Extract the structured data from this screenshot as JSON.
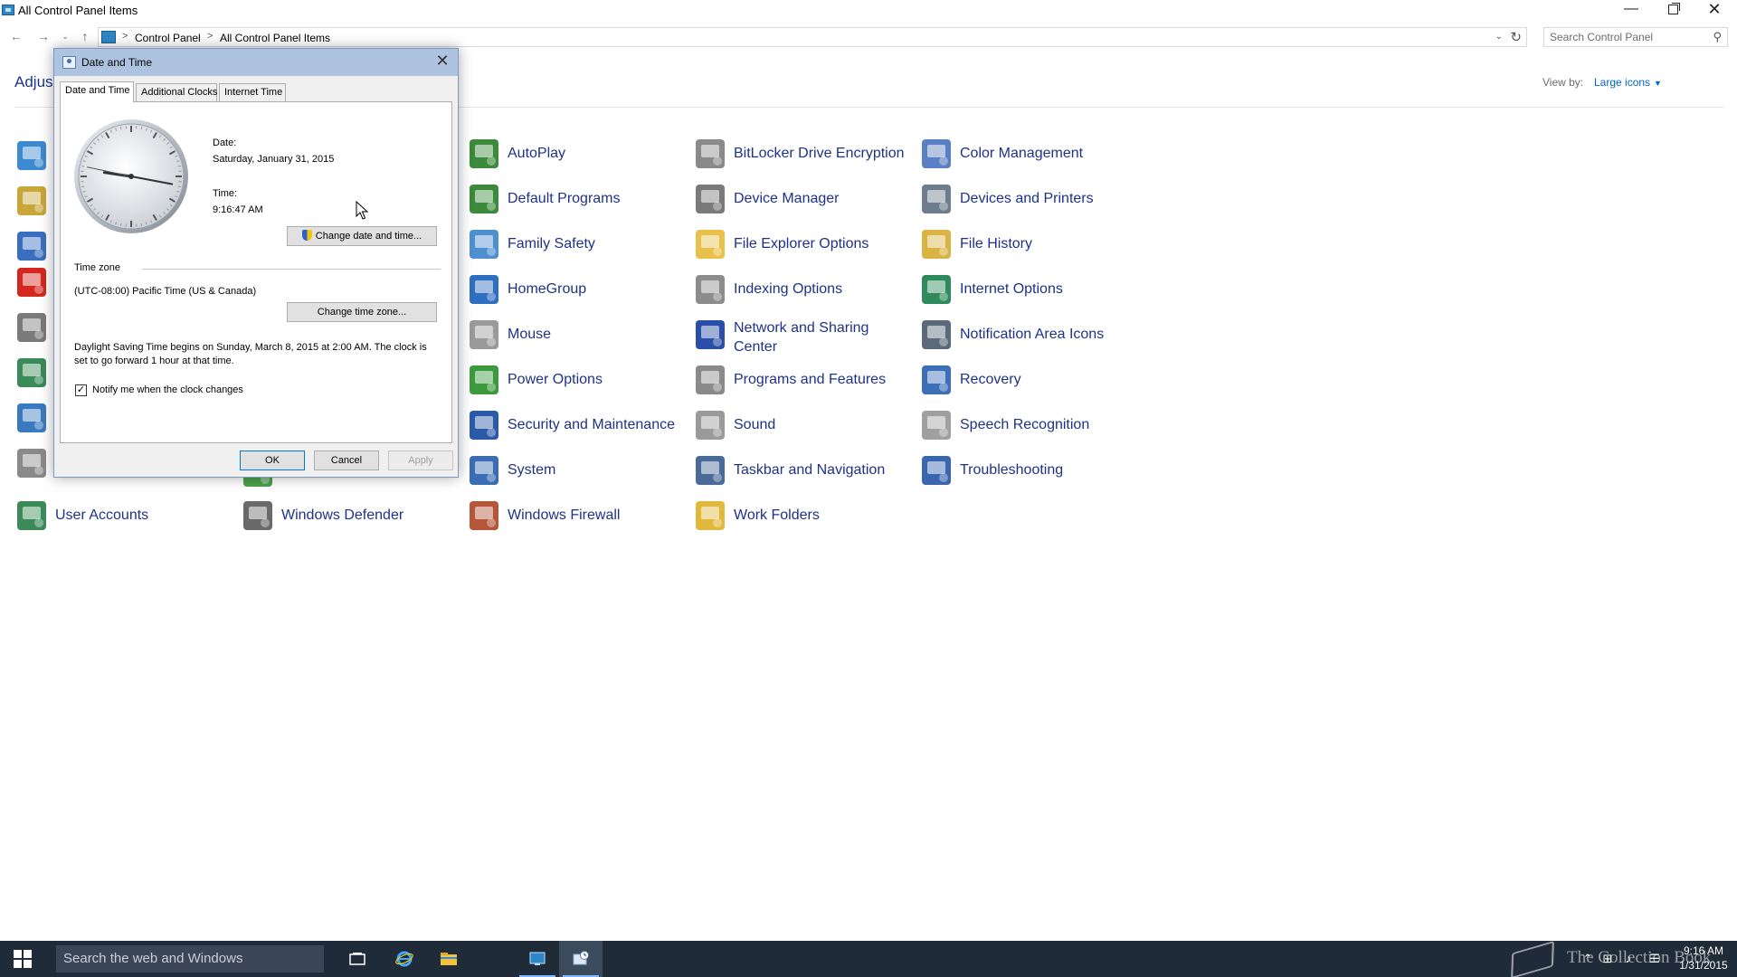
{
  "window": {
    "title": "All Control Panel Items",
    "minimize_glyph": "—",
    "close_glyph": "✕"
  },
  "navigation": {
    "back_glyph": "←",
    "forward_glyph": "→",
    "recent_glyph": "⌄",
    "up_glyph": "↑",
    "breadcrumb": [
      "Control Panel",
      "All Control Panel Items"
    ],
    "separator": ">",
    "dropdown_glyph": "⌄",
    "refresh_glyph": "↻"
  },
  "search": {
    "placeholder": "Search Control Panel",
    "icon_glyph": "⚲"
  },
  "header": {
    "title_partial": "Adjus",
    "view_by_label": "View by:",
    "view_by_value": "Large icons",
    "view_by_caret": "▼"
  },
  "items": [
    {
      "label": "AutoPlay",
      "icon": "autoplay-icon",
      "color": "#3c8a3c"
    },
    {
      "label": "BitLocker Drive Encryption",
      "icon": "bitlocker-icon",
      "color": "#8a8a8a"
    },
    {
      "label": "Color Management",
      "icon": "color-management-icon",
      "color": "#5b7fc4"
    },
    {
      "label": "Default Programs",
      "icon": "default-programs-icon",
      "color": "#3c8a3c"
    },
    {
      "label": "Device Manager",
      "icon": "device-manager-icon",
      "color": "#7a7a7a"
    },
    {
      "label": "Devices and Printers",
      "icon": "devices-printers-icon",
      "color": "#6d7d8d"
    },
    {
      "label": "Family Safety",
      "icon": "family-safety-icon",
      "color": "#4e8fd0"
    },
    {
      "label": "File Explorer Options",
      "icon": "file-explorer-options-icon",
      "color": "#e8c04a"
    },
    {
      "label": "File History",
      "icon": "file-history-icon",
      "color": "#d9b343"
    },
    {
      "label": "HomeGroup",
      "icon": "homegroup-icon",
      "color": "#2f6fbf"
    },
    {
      "label": "Indexing Options",
      "icon": "indexing-options-icon",
      "color": "#8c8c8c"
    },
    {
      "label": "Internet Options",
      "icon": "internet-options-icon",
      "color": "#2e8a5a"
    },
    {
      "label": "Mouse",
      "icon": "mouse-icon",
      "color": "#9a9a9a"
    },
    {
      "label": "Network and Sharing Center",
      "icon": "network-sharing-icon",
      "color": "#2a4fa8"
    },
    {
      "label": "Notification Area Icons",
      "icon": "notification-area-icon",
      "color": "#5a6a7a"
    },
    {
      "label": "Power Options",
      "icon": "power-options-icon",
      "color": "#3c9a3c"
    },
    {
      "label": "Programs and Features",
      "icon": "programs-features-icon",
      "color": "#8a8a8a"
    },
    {
      "label": "Recovery",
      "icon": "recovery-icon",
      "color": "#3d6fb8"
    },
    {
      "label": "Security and Maintenance",
      "icon": "security-maintenance-icon",
      "color": "#2a5aa8"
    },
    {
      "label": "Sound",
      "icon": "sound-icon",
      "color": "#9a9a9a"
    },
    {
      "label": "Speech Recognition",
      "icon": "speech-recognition-icon",
      "color": "#a0a0a0"
    },
    {
      "label": "System",
      "icon": "system-icon",
      "color": "#3b6db5"
    },
    {
      "label": "Taskbar and Navigation",
      "icon": "taskbar-navigation-icon",
      "color": "#4a6a9a"
    },
    {
      "label": "Troubleshooting",
      "icon": "troubleshooting-icon",
      "color": "#3a66b0"
    },
    {
      "label": "User Accounts",
      "icon": "user-accounts-icon",
      "color": "#3c8a5a"
    },
    {
      "label": "Windows Defender",
      "icon": "windows-defender-icon",
      "color": "#6a6a6a"
    },
    {
      "label": "Windows Firewall",
      "icon": "windows-firewall-icon",
      "color": "#b5553a"
    },
    {
      "label": "Work Folders",
      "icon": "work-folders-icon",
      "color": "#e0b83c"
    }
  ],
  "left_column_icons": [
    {
      "icon": "action-center-icon",
      "color": "#3c8ad0"
    },
    {
      "icon": "admin-tools-icon",
      "color": "#c9a63a"
    },
    {
      "icon": "display-icon",
      "color": "#3a6fc0"
    },
    {
      "icon": "flash-player-icon",
      "color": "#d4281e"
    },
    {
      "icon": "keyboard-icon",
      "color": "#7a7a7a"
    },
    {
      "icon": "remoteapp-icon",
      "color": "#3a8a5a"
    },
    {
      "icon": "region-icon",
      "color": "#3a7ac0"
    },
    {
      "icon": "storage-spaces-icon",
      "color": "#8a8a8a"
    },
    {
      "icon": "sync-center-icon",
      "color": "#4aa04a"
    }
  ],
  "dialog": {
    "title": "Date and Time",
    "close_glyph": "✕",
    "tabs": [
      "Date and Time",
      "Additional Clocks",
      "Internet Time"
    ],
    "active_tab": 0,
    "date_label": "Date:",
    "date_value": "Saturday, January 31, 2015",
    "time_label": "Time:",
    "time_value": "9:16:47 AM",
    "change_datetime_button": "Change date and time...",
    "time_zone_label": "Time zone",
    "time_zone_value": "(UTC-08:00) Pacific Time (US & Canada)",
    "change_timezone_button": "Change time zone...",
    "dst_text": "Daylight Saving Time begins on Sunday, March 8, 2015 at 2:00 AM. The clock is set to go forward 1 hour at that time.",
    "notify_label": "Notify me when the clock changes",
    "notify_checked": true,
    "check_glyph": "✓",
    "ok_button": "OK",
    "cancel_button": "Cancel",
    "apply_button": "Apply",
    "clock": {
      "hours": 9,
      "minutes": 16,
      "seconds": 47
    }
  },
  "taskbar": {
    "search_placeholder": "Search the web and Windows",
    "watermark": "The Collection Book",
    "tray_time": "9:16 AM",
    "tray_date": "1/31/2015",
    "tray_glyphs": {
      "chevron": "⌃",
      "network": "⊞",
      "volume": "♪",
      "notifications": "☰"
    },
    "apps": [
      {
        "name": "task-view",
        "icon": "task-view-icon"
      },
      {
        "name": "internet-explorer",
        "icon": "internet-explorer-icon"
      },
      {
        "name": "file-explorer",
        "icon": "file-explorer-icon"
      },
      {
        "name": "control-panel",
        "icon": "control-panel-icon"
      },
      {
        "name": "date-time",
        "icon": "date-time-icon"
      }
    ]
  }
}
